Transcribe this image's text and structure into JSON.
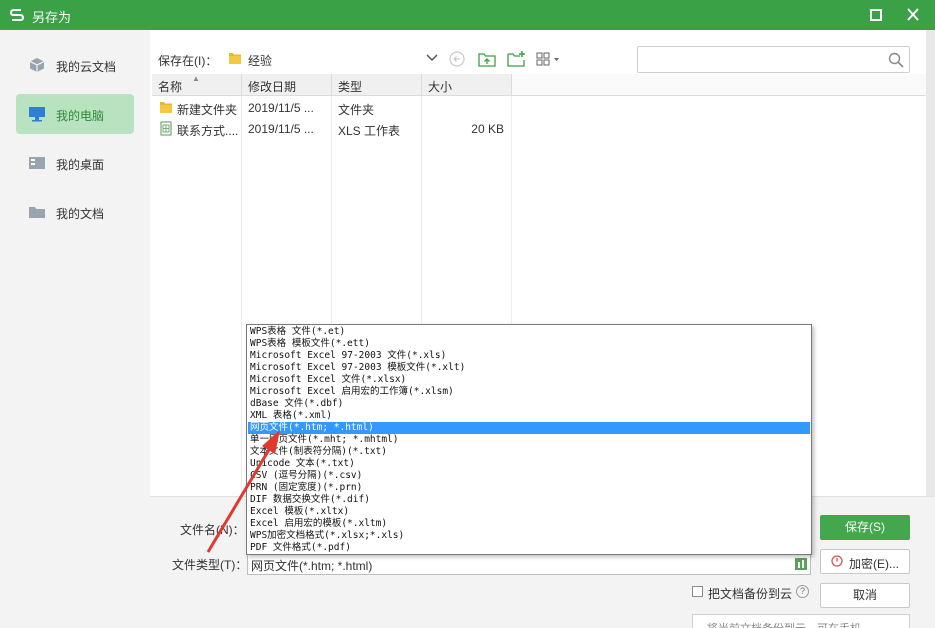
{
  "window": {
    "title": "另存为"
  },
  "sidebar": {
    "items": [
      {
        "label": "我的云文档",
        "icon": "cloud-cube-icon",
        "active": false
      },
      {
        "label": "我的电脑",
        "icon": "monitor-icon",
        "active": true
      },
      {
        "label": "我的桌面",
        "icon": "desktop-icon",
        "active": false
      },
      {
        "label": "我的文档",
        "icon": "folder-icon",
        "active": false
      }
    ]
  },
  "toolbar": {
    "save_in_label": "保存在(I)：",
    "current_folder": "经验",
    "search_placeholder": ""
  },
  "file_list": {
    "columns": [
      "名称",
      "修改日期",
      "类型",
      "大小"
    ],
    "rows": [
      {
        "name": "新建文件夹",
        "date": "2019/11/5 ...",
        "type": "文件夹",
        "size": "",
        "icon": "folder-icon"
      },
      {
        "name": "联系方式....",
        "date": "2019/11/5 ...",
        "type": "XLS 工作表",
        "size": "20 KB",
        "icon": "spreadsheet-file-icon"
      }
    ]
  },
  "form": {
    "file_name_label": "文件名(N)：",
    "file_type_label": "文件类型(T)：",
    "file_type_value": "网页文件(*.htm; *.html)",
    "backup_label": "把文档备份到云",
    "hint_text": "将当前文档备份到云，可在手机"
  },
  "buttons": {
    "save": "保存(S)",
    "encrypt": "加密(E)...",
    "cancel": "取消"
  },
  "dropdown": {
    "options": [
      "WPS表格 文件(*.et)",
      "WPS表格 模板文件(*.ett)",
      "Microsoft Excel 97-2003 文件(*.xls)",
      "Microsoft Excel 97-2003 模板文件(*.xlt)",
      "Microsoft Excel 文件(*.xlsx)",
      "Microsoft Excel 启用宏的工作簿(*.xlsm)",
      "dBase 文件(*.dbf)",
      "XML 表格(*.xml)",
      "网页文件(*.htm; *.html)",
      "单一网页文件(*.mht; *.mhtml)",
      "文本文件(制表符分隔)(*.txt)",
      "Unicode 文本(*.txt)",
      "CSV (逗号分隔)(*.csv)",
      "PRN (固定宽度)(*.prn)",
      "DIF 数据交换文件(*.dif)",
      "Excel 模板(*.xltx)",
      "Excel 启用宏的模板(*.xltm)",
      "WPS加密文档格式(*.xlsx;*.xls)",
      "PDF 文件格式(*.pdf)"
    ],
    "selected_index": 8
  },
  "colors": {
    "titlebar": "#3aa146",
    "active_sidebar": "#b9e3c0",
    "save_button": "#43a84d",
    "selection": "#3399ff",
    "annotation_arrow": "#e03a2f"
  }
}
